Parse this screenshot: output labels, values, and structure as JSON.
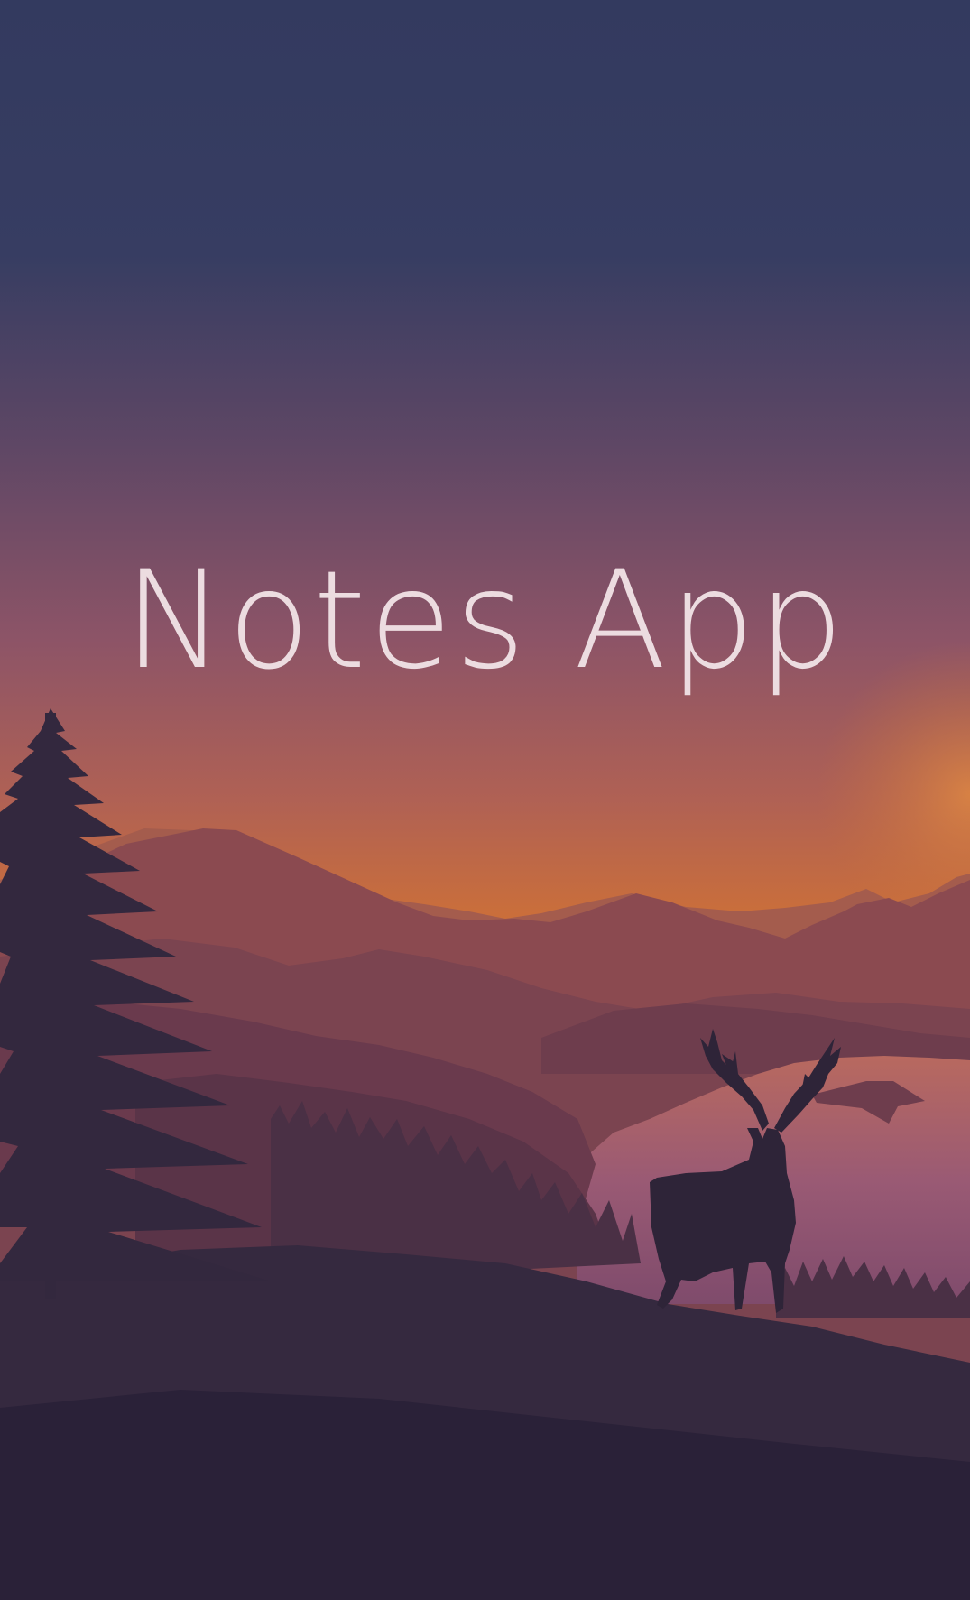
{
  "splash": {
    "title": "Notes App",
    "background": {
      "name": "sunset-mountain-lake-deer-wallpaper",
      "colors": {
        "sky_top": "#333a5f",
        "sky_mid": "#8b5469",
        "horizon": "#d27236",
        "far_mountains": "#8b4a50",
        "mid_mountains": "#6e3d4d",
        "near_hills": "#4a3045",
        "foreground": "#2a2138",
        "lake": "#9a5a74",
        "silhouettes": "#2e2438",
        "title_text": "#ecdce0"
      }
    }
  }
}
